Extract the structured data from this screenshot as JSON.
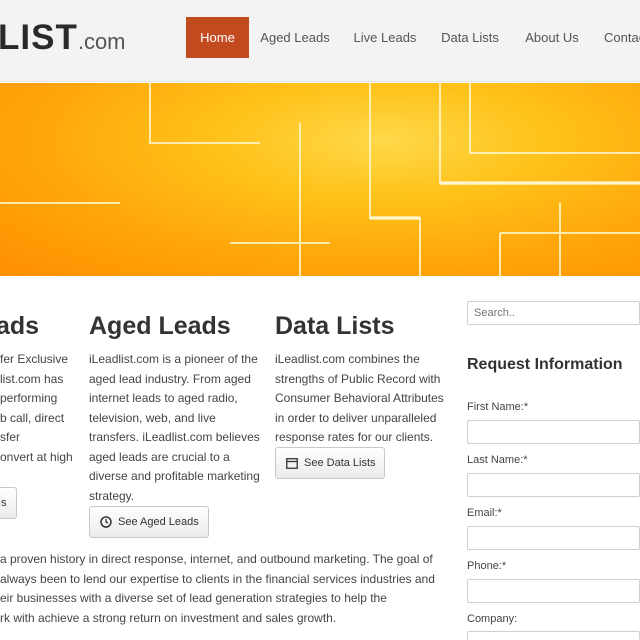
{
  "logo": {
    "main": "LIST",
    "suffix": ".com"
  },
  "nav": {
    "items": [
      {
        "label": "Home",
        "active": true
      },
      {
        "label": "Aged Leads",
        "active": false
      },
      {
        "label": "Live Leads",
        "active": false
      },
      {
        "label": "Data Lists",
        "active": false
      },
      {
        "label": "About Us",
        "active": false
      },
      {
        "label": "Contac",
        "active": false
      }
    ]
  },
  "columns": {
    "live": {
      "title": "ads",
      "lines": [
        "fer Exclusive",
        "list.com has",
        "performing",
        "b call, direct",
        "sfer",
        "onvert at high"
      ],
      "button_label": "s"
    },
    "aged": {
      "title": "Aged Leads",
      "lines": [
        "iLeadlist.com is a pioneer of the",
        "aged lead industry. From aged",
        "internet leads to aged radio,",
        "television, web, and live",
        "transfers. iLeadlist.com believes",
        "aged leads are crucial to a",
        "diverse and profitable marketing",
        "strategy."
      ],
      "button_label": "See Aged Leads",
      "button_icon": "clock-icon"
    },
    "data": {
      "title": "Data Lists",
      "lines": [
        "iLeadlist.com combines the",
        "strengths of Public Record with",
        "Consumer Behavioral Attributes",
        "in order to deliver unparalleled",
        "response rates for our clients."
      ],
      "button_label": "See Data Lists",
      "button_icon": "calendar-icon"
    }
  },
  "bottom_text": {
    "lines": [
      "a proven history in direct response, internet, and outbound marketing. The goal of",
      "always been to lend our expertise to clients in the financial services industries and",
      "eir businesses with a diverse set of lead generation strategies to help the",
      "rk with achieve a strong return on investment and sales growth."
    ]
  },
  "sidebar": {
    "search_placeholder": "Search..",
    "title": "Request Information",
    "fields": [
      "First Name:*",
      "Last Name:*",
      "Email:*",
      "Phone:*",
      "Company:"
    ]
  },
  "colors": {
    "accent": "#c14a1f",
    "banner": "#ffb20f"
  }
}
